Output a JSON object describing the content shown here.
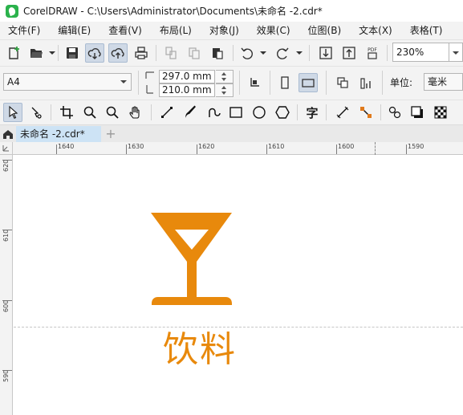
{
  "window": {
    "title": "CorelDRAW - C:\\Users\\Administrator\\Documents\\未命名 -2.cdr*"
  },
  "menu": [
    "文件(F)",
    "编辑(E)",
    "查看(V)",
    "布局(L)",
    "对象(J)",
    "效果(C)",
    "位图(B)",
    "文本(X)",
    "表格(T)"
  ],
  "toolbar": {
    "zoom": "230%",
    "pdf_label": "PDF"
  },
  "property_bar": {
    "page_size": "A4",
    "width": "297.0 mm",
    "height": "210.0 mm",
    "units_label": "单位:",
    "units": "毫米"
  },
  "toolbox": {
    "text_tool": "字"
  },
  "tabs": {
    "document": "未命名 -2.cdr*",
    "add": "+"
  },
  "ruler": {
    "horizontal": [
      "1640",
      "1630",
      "1620",
      "1610",
      "1600",
      "1590"
    ],
    "vertical": [
      "620",
      "610",
      "600",
      "590"
    ]
  },
  "canvas": {
    "label": "饮料",
    "accent_color": "#e8890c"
  },
  "icons": [
    "app-logo-icon",
    "new-document-icon",
    "open-folder-icon",
    "save-icon",
    "cloud-import-icon",
    "cloud-export-icon",
    "print-icon",
    "cut-icon",
    "copy-icon",
    "paste-icon",
    "undo-icon",
    "redo-icon",
    "import-icon",
    "export-icon",
    "pdf-icon",
    "portrait-icon",
    "landscape-icon",
    "all-pages-icon",
    "current-page-icon",
    "bleed-icon",
    "pick-tool-icon",
    "shape-tool-icon",
    "crop-tool-icon",
    "zoom-tool-icon",
    "pan-tool-icon",
    "freehand-tool-icon",
    "artistic-media-icon",
    "pen-tool-icon",
    "rectangle-tool-icon",
    "ellipse-tool-icon",
    "polygon-tool-icon",
    "text-tool-icon",
    "parallel-dimension-icon",
    "connector-tool-icon",
    "interactive-blend-icon",
    "drop-shadow-icon",
    "transparency-icon",
    "home-icon",
    "cocktail-glass-icon"
  ]
}
